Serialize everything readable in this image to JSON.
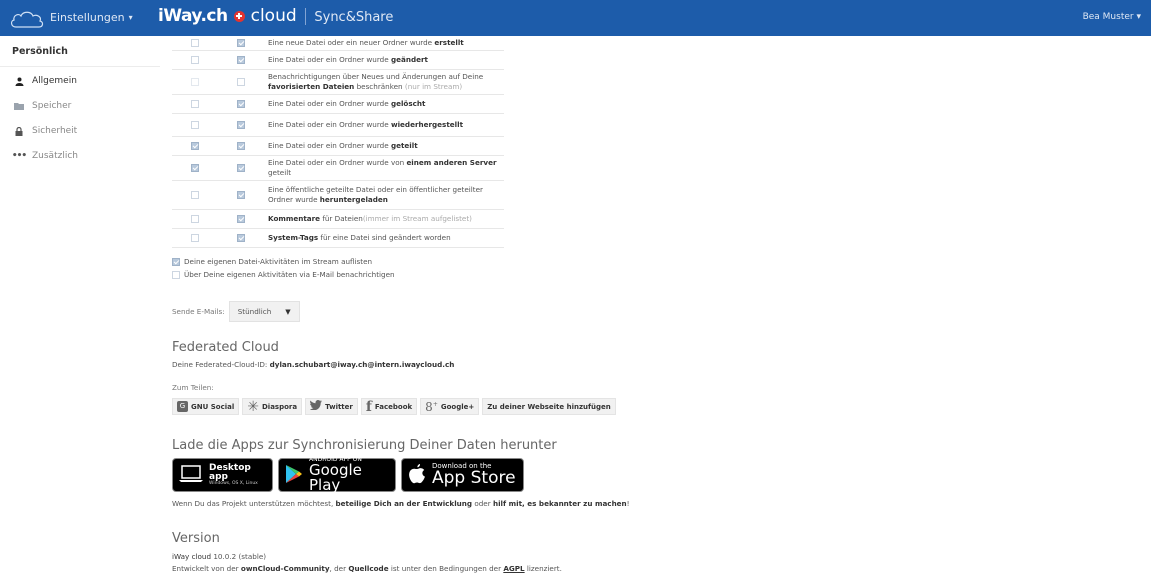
{
  "header": {
    "settings_menu": "Einstellungen",
    "brand_iway": "iWay.ch",
    "brand_cloud": "cloud",
    "brand_sep": "|",
    "brand_sync": "Sync&Share",
    "user": "Bea Muster",
    "bg_color": "#1d5caa"
  },
  "sidebar": {
    "title": "Persönlich",
    "items": [
      {
        "label": "Allgemein",
        "icon": "user-icon",
        "active": true
      },
      {
        "label": "Speicher",
        "icon": "folder-icon",
        "active": false
      },
      {
        "label": "Sicherheit",
        "icon": "lock-icon",
        "active": false
      },
      {
        "label": "Zusätzlich",
        "icon": "more-icon",
        "active": false
      }
    ]
  },
  "notifications": {
    "rows": [
      {
        "text_pre": "Eine neue Datei oder ein neuer Ordner wurde ",
        "text_bold": "erstellt",
        "text_post": "",
        "c1": false,
        "c2": true
      },
      {
        "text_pre": "Eine Datei oder ein Ordner wurde ",
        "text_bold": "geändert",
        "text_post": "",
        "c1": false,
        "c2": true
      },
      {
        "text_pre": "Benachrichtigungen über Neues und Änderungen auf Deine ",
        "text_bold": "favorisierten Dateien",
        "text_post": " beschränken",
        "text_muted": " (nur im Stream)",
        "c1": false,
        "c2": false
      },
      {
        "text_pre": "Eine Datei oder ein Ordner wurde ",
        "text_bold": "gelöscht",
        "text_post": "",
        "c1": false,
        "c2": true
      },
      {
        "text_pre": "Eine Datei oder ein Ordner wurde ",
        "text_bold": "wiederhergestellt",
        "text_post": "",
        "c1": false,
        "c2": true
      },
      {
        "text_pre": "Eine Datei oder ein Ordner wurde ",
        "text_bold": "geteilt",
        "text_post": "",
        "c1": true,
        "c2": true
      },
      {
        "text_pre": "Eine Datei oder ein Ordner wurde von ",
        "text_bold": "einem anderen Server",
        "text_post": " geteilt",
        "c1": true,
        "c2": true
      },
      {
        "text_pre": "Eine öffentliche geteilte Datei oder ein öffentlicher geteilter Ordner wurde ",
        "text_bold": "heruntergeladen",
        "text_post": "",
        "c1": false,
        "c2": true
      },
      {
        "text_pre": "",
        "text_bold": "Kommentare",
        "text_post": " für Dateien",
        "text_muted": "(immer im Stream aufgelistet)",
        "c1": false,
        "c2": true
      },
      {
        "text_pre": "",
        "text_bold": "System-Tags",
        "text_post": " für eine Datei sind geändert worden",
        "c1": false,
        "c2": true
      }
    ]
  },
  "options": {
    "stream_own": "Deine eigenen Datei-Aktivitäten im Stream auflisten",
    "email_own": "Über Deine eigenen Aktivitäten via E-Mail benachrichtigen",
    "send_label": "Sende E-Mails:",
    "send_value": "Stündlich"
  },
  "federated": {
    "heading": "Federated Cloud",
    "id_label": "Deine Federated-Cloud-ID:",
    "id_value": "dylan.schubart@iway.ch@intern.iwaycloud.ch",
    "share_label": "Zum Teilen:",
    "share_buttons": [
      {
        "label": "GNU Social",
        "icon": "gnu-social-icon"
      },
      {
        "label": "Diaspora",
        "icon": "diaspora-icon"
      },
      {
        "label": "Twitter",
        "icon": "twitter-icon"
      },
      {
        "label": "Facebook",
        "icon": "facebook-icon"
      },
      {
        "label": "Google+",
        "icon": "google-plus-icon"
      },
      {
        "label": "Zu deiner Webseite hinzufügen",
        "icon": ""
      }
    ]
  },
  "apps": {
    "heading": "Lade die Apps zur Synchronisierung Deiner Daten herunter",
    "desktop_big": "Desktop app",
    "desktop_small": "Windows, OS X, Linux",
    "play_top": "ANDROID APP ON",
    "play_big": "Google Play",
    "apple_top": "Download on the",
    "apple_big": "App Store",
    "support_pre": "Wenn Du das Projekt unterstützen möchtest, ",
    "support_b1": "beteilige Dich an der Entwicklung",
    "support_mid": " oder ",
    "support_b2": "hilf mit, es bekannter zu machen",
    "support_end": "!"
  },
  "version": {
    "heading": "Version",
    "name": "iWay cloud",
    "number": " 10.0.2 (stable)",
    "dev_pre": "Entwickelt von der ",
    "dev_b1": "ownCloud-Community",
    "dev_mid": ", der ",
    "dev_b2": "Quellcode",
    "dev_mid2": " ist unter den Bedingungen der ",
    "dev_b3": "AGPL",
    "dev_end": " lizenziert."
  }
}
